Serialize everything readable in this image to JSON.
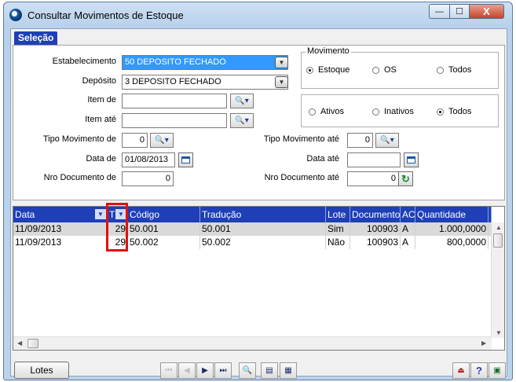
{
  "window": {
    "title": "Consultar Movimentos de Estoque",
    "minimize_glyph": "—",
    "maximize_glyph": "☐",
    "close_glyph": "X"
  },
  "tab": {
    "label": "Seleção"
  },
  "form": {
    "estabelecimento": {
      "label": "Estabelecimento",
      "value": "50 DEPOSITO FECHADO"
    },
    "deposito": {
      "label": "Depósito",
      "value": "3 DEPOSITO FECHADO"
    },
    "item_de": {
      "label": "Item de",
      "value": ""
    },
    "item_ate": {
      "label": "Item até",
      "value": ""
    },
    "tipo_mov_de": {
      "label": "Tipo Movimento de",
      "value": "0"
    },
    "tipo_mov_ate": {
      "label": "Tipo Movimento até",
      "value": "0"
    },
    "data_de": {
      "label": "Data de",
      "value": "01/08/2013"
    },
    "data_ate": {
      "label": "Data até",
      "value": ""
    },
    "nro_doc_de": {
      "label": "Nro Documento de",
      "value": "0"
    },
    "nro_doc_ate": {
      "label": "Nro Documento até",
      "value": "0"
    }
  },
  "movimento": {
    "title": "Movimento",
    "options": [
      "Estoque",
      "OS",
      "Todos"
    ],
    "selected": "Estoque"
  },
  "status": {
    "options": [
      "Ativos",
      "Inativos",
      "Todos"
    ],
    "selected": "Todos"
  },
  "grid": {
    "columns": [
      "Data",
      "T",
      "Código",
      "Tradução",
      "Lote",
      "Documento",
      "AC",
      "Quantidade"
    ],
    "rows": [
      [
        "11/09/2013",
        "29",
        "50.001",
        "50.001",
        "Sim",
        "100903",
        "A",
        "1.000,0000"
      ],
      [
        "11/09/2013",
        "29",
        "50.002",
        "50.002",
        "Não",
        "100903",
        "A",
        "800,0000"
      ]
    ]
  },
  "footer": {
    "lotes_label": "Lotes"
  },
  "colors": {
    "header_blue": "#1e3fb8",
    "highlight_red": "#e01010",
    "selected_field": "#3399ff"
  }
}
